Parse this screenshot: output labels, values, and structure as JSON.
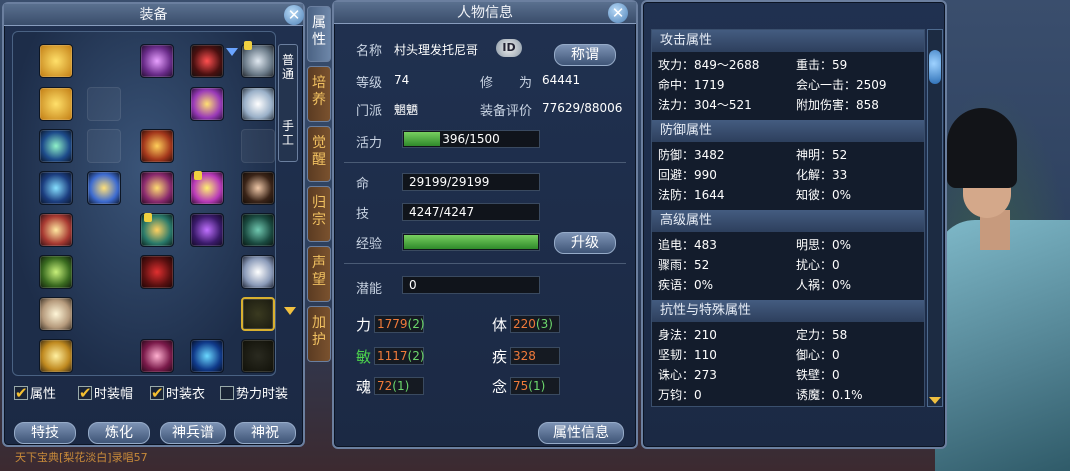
{
  "equip_panel": {
    "title": "装备",
    "side_tabs": [
      "普通",
      "手工"
    ],
    "checkboxes": [
      {
        "label": "属性",
        "checked": true
      },
      {
        "label": "时装帽",
        "checked": true
      },
      {
        "label": "时装衣",
        "checked": true
      },
      {
        "label": "势力时装",
        "checked": false
      }
    ],
    "buttons": [
      "特技",
      "炼化",
      "神兵谱",
      "神祝"
    ]
  },
  "vertical_tabs": [
    "属性",
    "培养",
    "觉醒",
    "归宗",
    "声望",
    "加护"
  ],
  "info_panel": {
    "title": "人物信息",
    "name_label": "名称",
    "name_value": "村头理发托尼哥",
    "id_badge": "ID",
    "title_button": "称谓",
    "level_label": "等级",
    "level_value": "74",
    "cultivation_label": "修　　为",
    "cultivation_value": "64441",
    "sect_label": "门派",
    "sect_value": "魍魉",
    "equip_score_label": "装备评价",
    "equip_score_value": "77629/88006",
    "vitality_label": "活力",
    "vitality_value": "396/1500",
    "vitality_fraction": 0.264,
    "hp_label": "命",
    "hp_value": "29199/29199",
    "skill_label": "技",
    "skill_value": "4247/4247",
    "exp_label": "经验",
    "exp_fraction": 1.0,
    "upgrade_button": "升级",
    "potential_label": "潜能",
    "potential_value": "0",
    "stats": [
      {
        "label": "力",
        "value": "1779",
        "bonus": "(2)",
        "label_color": "#ffffff"
      },
      {
        "label": "体",
        "value": "220",
        "bonus": "(3)",
        "label_color": "#ffffff"
      },
      {
        "label": "敏",
        "value": "1117",
        "bonus": "(2)",
        "label_color": "#4cd34c"
      },
      {
        "label": "疾",
        "value": "328",
        "bonus": "",
        "label_color": "#ffffff"
      },
      {
        "label": "魂",
        "value": "72",
        "bonus": "(1)",
        "label_color": "#ffffff"
      },
      {
        "label": "念",
        "value": "75",
        "bonus": "(1)",
        "label_color": "#ffffff"
      }
    ],
    "attr_info_button": "属性信息"
  },
  "attr_panel": {
    "sections": [
      {
        "header": "攻击属性",
        "lines": [
          [
            "攻力：849～2688",
            "重击：59"
          ],
          [
            "命中：1719",
            "会心一击：2509"
          ],
          [
            "法力：304～521",
            "附加伤害：858"
          ]
        ]
      },
      {
        "header": "防御属性",
        "lines": [
          [
            "防御：3482",
            "神明：52"
          ],
          [
            "回避：990",
            "化解：33"
          ],
          [
            "法防：1644",
            "知彼：0%"
          ]
        ]
      },
      {
        "header": "高级属性",
        "lines": [
          [
            "追电：483",
            "明思：0%"
          ],
          [
            "骤雨：52",
            "扰心：0"
          ],
          [
            "疾语：0%",
            "人祸：0%"
          ]
        ]
      },
      {
        "header": "抗性与特殊属性",
        "lines": [
          [
            "身法：210",
            "定力：58"
          ],
          [
            "坚韧：110",
            "御心：0"
          ],
          [
            "诛心：273",
            "铁壁：0"
          ],
          [
            "万钧：0",
            "诱魔：0.1%"
          ]
        ]
      }
    ]
  },
  "bottom_chat": "天下宝典[梨花淡白]录唱57"
}
